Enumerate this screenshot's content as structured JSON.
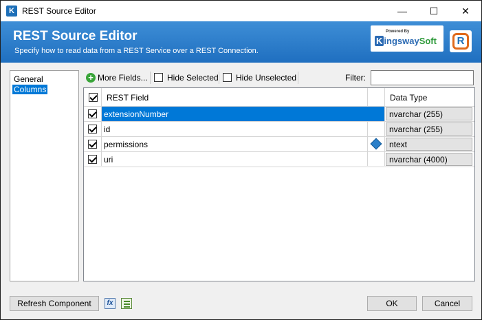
{
  "window": {
    "title": "REST Source Editor",
    "minimize_glyph": "—",
    "maximize_glyph": "☐",
    "close_glyph": "✕",
    "app_icon_glyph": "K"
  },
  "banner": {
    "title": "REST Source Editor",
    "subtitle": "Specify how to read data from a REST Service over a REST Connection.",
    "logo_powered": "Powered By",
    "logo_k": "K",
    "logo_ingsway": "ingsway",
    "logo_soft": "Soft",
    "r_logo": "R"
  },
  "nav": {
    "items": [
      {
        "label": "General",
        "selected": false
      },
      {
        "label": "Columns",
        "selected": true
      }
    ]
  },
  "toolbar": {
    "more_fields_label": "More Fields...",
    "hide_selected_label": "Hide Selected",
    "hide_unselected_label": "Hide Unselected",
    "filter_label": "Filter:",
    "filter_value": "",
    "plus_glyph": "+"
  },
  "grid": {
    "columns": [
      "REST Field",
      "Data Type"
    ],
    "rows": [
      {
        "checked": true,
        "field": "extensionNumber",
        "data_type": "nvarchar (255)",
        "selected": true,
        "has_info_icon": false
      },
      {
        "checked": true,
        "field": "id",
        "data_type": "nvarchar (255)",
        "selected": false,
        "has_info_icon": false
      },
      {
        "checked": true,
        "field": "permissions",
        "data_type": "ntext",
        "selected": false,
        "has_info_icon": true
      },
      {
        "checked": true,
        "field": "uri",
        "data_type": "nvarchar (4000)",
        "selected": false,
        "has_info_icon": false
      }
    ]
  },
  "footer": {
    "refresh_label": "Refresh Component",
    "fx_glyph": "fx",
    "ok_label": "OK",
    "cancel_label": "Cancel"
  },
  "colors": {
    "accent": "#0078d7",
    "banner": "#2a7ccd",
    "brand_orange": "#e06a1c",
    "brand_green": "#2e9a3a"
  }
}
